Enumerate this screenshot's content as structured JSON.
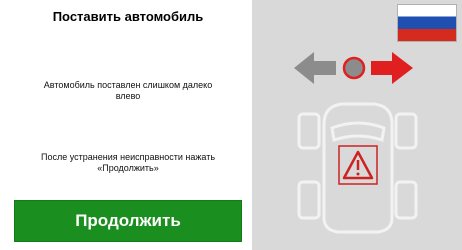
{
  "screen": {
    "title": "Поставить автомобиль",
    "message": "Автомобиль поставлен слишком далеко влево",
    "instruction": "После устранения неисправности нажать «Продолжить»",
    "continue_label": "Продолжить"
  },
  "colors": {
    "button_green": "#1a8f1f",
    "arrow_right_red": "#e02020",
    "arrow_left_gray": "#8c8c8c",
    "panel_gray": "#d9d9d9",
    "warning_red": "#cc2222"
  },
  "icons": {
    "language_flag": "russian-flag-icon",
    "direction": "arrows-left-right-icon",
    "vehicle": "car-top-view-icon",
    "warning": "warning-triangle-icon"
  }
}
